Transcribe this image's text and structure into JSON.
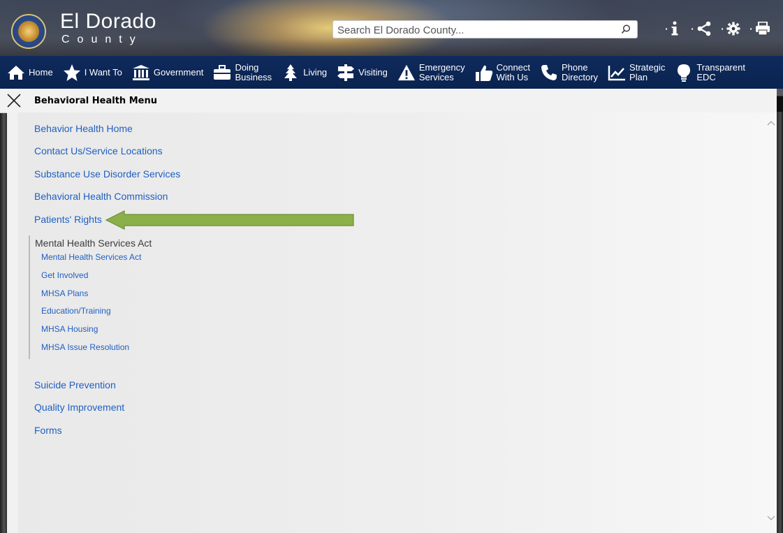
{
  "header": {
    "title": "El Dorado",
    "subtitle": "County",
    "search_placeholder": "Search El Dorado County...",
    "utility_icons": [
      "info-icon",
      "share-icon",
      "gear-icon",
      "print-icon"
    ]
  },
  "nav": {
    "items": [
      {
        "label": "Home",
        "icon": "home-icon"
      },
      {
        "label": "I Want To",
        "icon": "star-icon"
      },
      {
        "label": "Government",
        "icon": "capitol-icon"
      },
      {
        "label": "Doing\nBusiness",
        "icon": "briefcase-icon"
      },
      {
        "label": "Living",
        "icon": "tree-icon"
      },
      {
        "label": "Visiting",
        "icon": "signpost-icon"
      },
      {
        "label": "Emergency\nServices",
        "icon": "warning-icon"
      },
      {
        "label": "Connect\nWith Us",
        "icon": "thumbs-up-icon"
      },
      {
        "label": "Phone\nDirectory",
        "icon": "phone-icon"
      },
      {
        "label": "Strategic\nPlan",
        "icon": "chart-icon"
      },
      {
        "label": "Transparent\nEDC",
        "icon": "lightbulb-icon"
      }
    ],
    "colors": {
      "bar": "#0f2a5c"
    }
  },
  "menu": {
    "title": "Behavioral Health Menu",
    "links": [
      {
        "label": "Behavior Health Home"
      },
      {
        "label": "Contact Us/Service Locations"
      },
      {
        "label": "Substance Use Disorder Services"
      },
      {
        "label": "Behavioral Health Commission"
      },
      {
        "label": "Patients' Rights"
      }
    ],
    "subgroup": {
      "heading": "Mental Health Services Act",
      "links": [
        {
          "label": "Mental Health Services Act"
        },
        {
          "label": "Get Involved"
        },
        {
          "label": "MHSA Plans"
        },
        {
          "label": "Education/Training"
        },
        {
          "label": "MHSA Housing"
        },
        {
          "label": "MHSA Issue Resolution"
        }
      ]
    },
    "links_after": [
      {
        "label": "Suicide Prevention"
      },
      {
        "label": "Quality Improvement"
      },
      {
        "label": "Forms"
      }
    ],
    "link_color": "#1f5fc2",
    "annotation_arrow_color": "#8bb04a"
  }
}
